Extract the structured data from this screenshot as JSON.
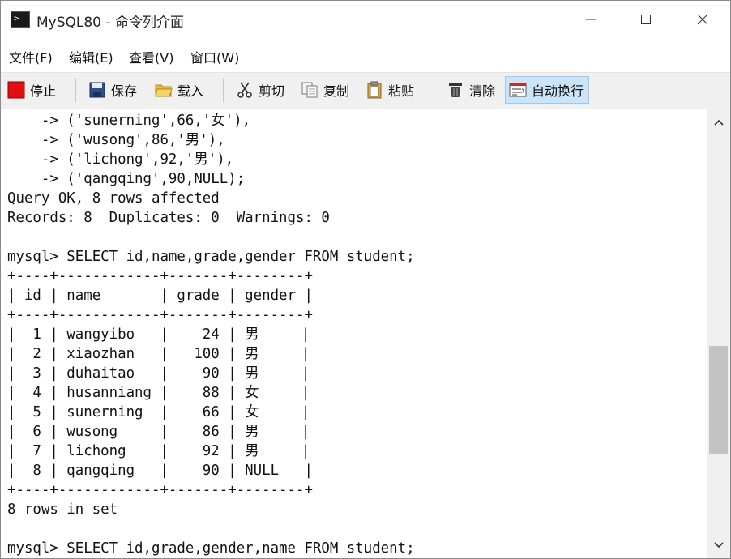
{
  "window": {
    "title": "MySQL80 - 命令列介面",
    "icon": "terminal-icon",
    "controls": [
      "minimize-icon",
      "maximize-icon",
      "close-icon"
    ]
  },
  "menu": {
    "items": [
      {
        "label": "文件(F)"
      },
      {
        "label": "编辑(E)"
      },
      {
        "label": "查看(V)"
      },
      {
        "label": "窗口(W)"
      }
    ]
  },
  "toolbar": {
    "buttons": [
      {
        "label": "停止",
        "icon": "stop-icon",
        "color": "#e01010"
      },
      {
        "label": "保存",
        "icon": "save-icon"
      },
      {
        "label": "载入",
        "icon": "folder-open-icon",
        "color": "#e8b83a"
      },
      {
        "label": "剪切",
        "icon": "scissors-icon"
      },
      {
        "label": "复制",
        "icon": "copy-icon"
      },
      {
        "label": "粘贴",
        "icon": "paste-icon"
      },
      {
        "label": "清除",
        "icon": "trash-icon"
      },
      {
        "label": "自动换行",
        "icon": "word-wrap-icon",
        "active": true
      }
    ]
  },
  "console": {
    "text": "    -> ('sunerning',66,'女'),\n    -> ('wusong',86,'男'),\n    -> ('lichong',92,'男'),\n    -> ('qangqing',90,NULL);\nQuery OK, 8 rows affected\nRecords: 8  Duplicates: 0  Warnings: 0\n\nmysql> SELECT id,name,grade,gender FROM student;\n+----+------------+-------+--------+\n| id | name       | grade | gender |\n+----+------------+-------+--------+\n|  1 | wangyibo   |    24 | 男     |\n|  2 | xiaozhan   |   100 | 男     |\n|  3 | duhaitao   |    90 | 男     |\n|  4 | husanniang |    88 | 女     |\n|  5 | sunerning  |    66 | 女     |\n|  6 | wusong     |    86 | 男     |\n|  7 | lichong    |    92 | 男     |\n|  8 | qangqing   |    90 | NULL   |\n+----+------------+-------+--------+\n8 rows in set\n\nmysql> SELECT id,grade,gender,name FROM student;"
  },
  "scrollbar": {
    "position_fraction": 0.62
  }
}
